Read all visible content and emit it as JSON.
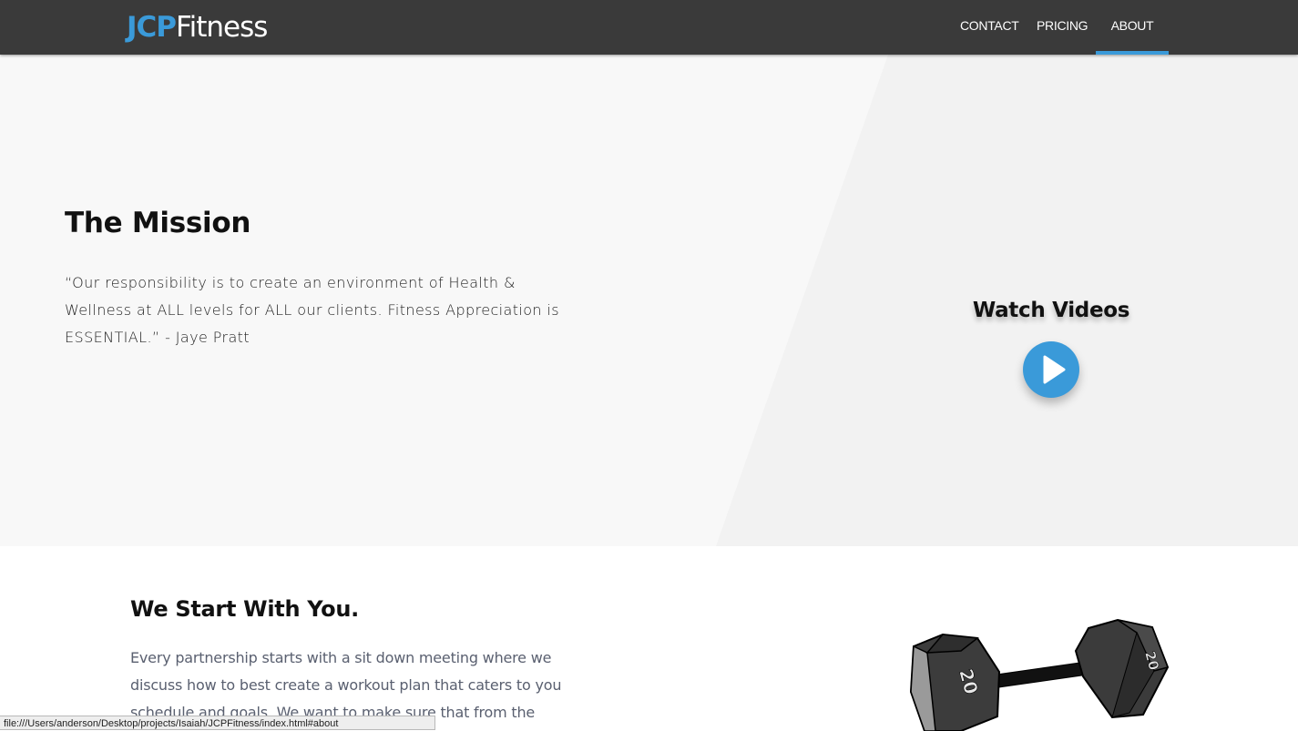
{
  "navbar": {
    "logo_part1": "JCP",
    "logo_part2": "Fitness",
    "items": [
      {
        "label": "CONTACT"
      },
      {
        "label": "PRICING"
      },
      {
        "label": "ABOUT",
        "active": true
      }
    ]
  },
  "hero": {
    "title": "The Mission",
    "quote": "“Our responsibility is to create an environment of Health & Wellness at ALL levels for ALL our clients. Fitness Appreciation is ESSENTIAL.” - Jaye Pratt",
    "watch_label": "Watch Videos"
  },
  "section2": {
    "title": "We Start With You.",
    "text": "Every partnership starts with a sit down meeting where we discuss how to best create a workout plan that caters to you schedule and goals. We want to make sure that from the",
    "dumbbell_weight_left": "20",
    "dumbbell_weight_right": "20"
  },
  "status_bar": {
    "url": "file:///Users/anderson/Desktop/projects/Isaiah/JCPFitness/index.html#about"
  },
  "colors": {
    "accent": "#3a9ad9",
    "navbar": "#3a3a3a",
    "hero_bg": "#f8f8f8"
  },
  "icons": {
    "play": "play-icon",
    "dumbbell": "dumbbell-icon"
  }
}
